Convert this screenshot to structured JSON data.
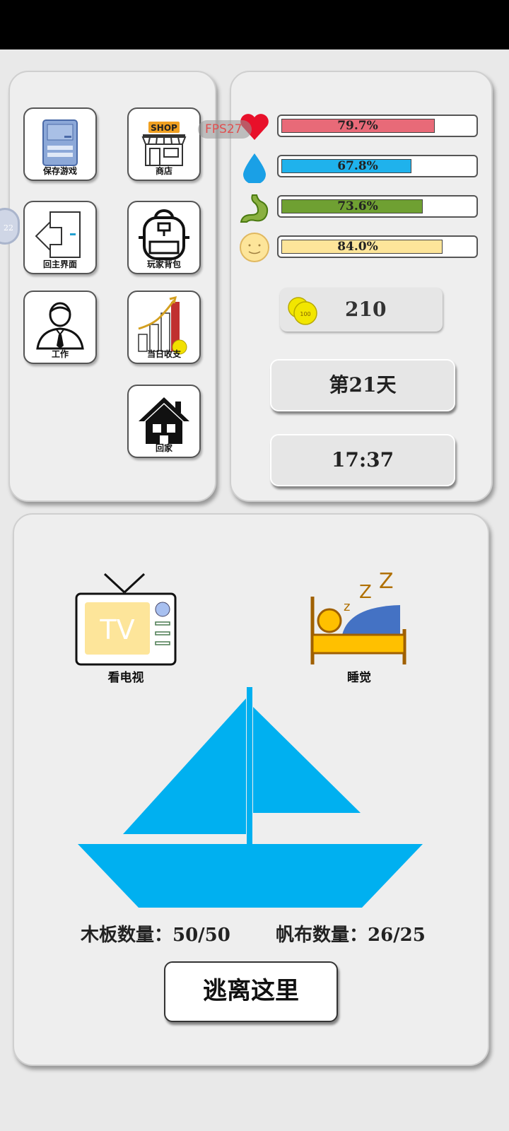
{
  "menu": {
    "save_label": "保存游戏",
    "shop_label": "商店",
    "shop_sign": "SHOP",
    "main_label": "回主界面",
    "bag_label": "玩家背包",
    "work_label": "工作",
    "income_label": "当日收支",
    "home_label": "回家"
  },
  "debug": {
    "fps": "FPS27",
    "ball_text": "22"
  },
  "stats": {
    "health": {
      "pct_text": "79.7%",
      "value": 0.797,
      "color": "#e86a78"
    },
    "water": {
      "pct_text": "67.8%",
      "value": 0.678,
      "color": "#1fb2ec"
    },
    "hunger": {
      "pct_text": "73.6%",
      "value": 0.736,
      "color": "#6fa032"
    },
    "mood": {
      "pct_text": "84.0%",
      "value": 0.84,
      "color": "#fde59a"
    }
  },
  "money": {
    "amount": "210",
    "coin_text": "100"
  },
  "day_label": "第21天",
  "time_label": "17:37",
  "activities": {
    "tv_label": "看电视",
    "tv_text": "TV",
    "sleep_label": "睡觉"
  },
  "boat": {
    "planks_text": "木板数量：50/50",
    "canvas_text": "帆布数量：26/25",
    "escape_label": "逃离这里",
    "color": "#00b0f0"
  }
}
